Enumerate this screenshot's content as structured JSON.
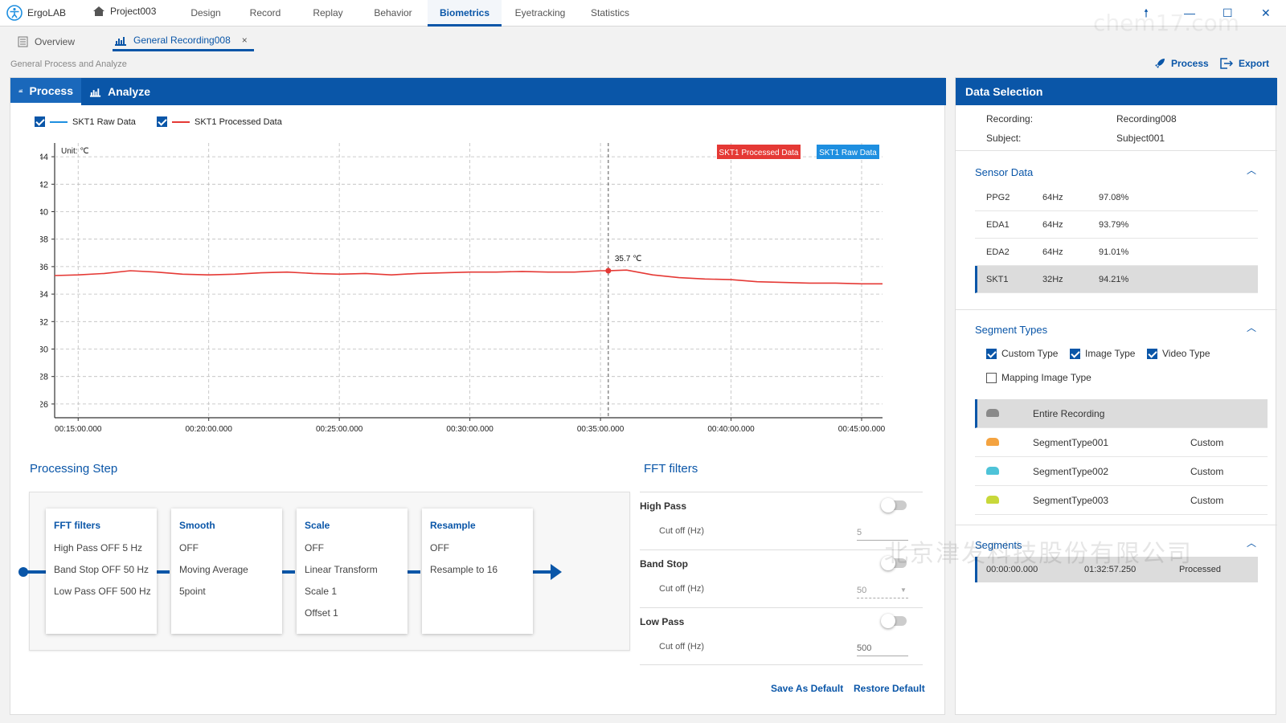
{
  "app": {
    "brand": "ErgoLAB",
    "project": "Project003"
  },
  "nav": [
    "Design",
    "Record",
    "Replay",
    "Behavior",
    "Biometrics",
    "Eyetracking",
    "Statistics"
  ],
  "nav_active": "Biometrics",
  "window_buttons": {
    "pin": "🠕",
    "minimize": "—",
    "maximize": "☐",
    "close": "✕"
  },
  "tabs": [
    {
      "label": "Overview"
    },
    {
      "label": "General Recording008",
      "close": "×"
    }
  ],
  "breadcrumb": "General Process and Analyze",
  "actions": {
    "process": "Process",
    "export": "Export"
  },
  "left_tabs": {
    "process": "Process",
    "analyze": "Analyze"
  },
  "legend": [
    {
      "label": "SKT1 Raw Data",
      "color": "#1e8fe0",
      "checked": true
    },
    {
      "label": "SKT1 Processed Data",
      "color": "#e53935",
      "checked": true
    }
  ],
  "chart_data": {
    "type": "line",
    "unit_label": "Unit: ℃",
    "ylim": [
      25,
      45
    ],
    "yticks": [
      26,
      28,
      30,
      32,
      34,
      36,
      38,
      40,
      42,
      44
    ],
    "xticks": [
      "00:15:00.000",
      "00:20:00.000",
      "00:25:00.000",
      "00:30:00.000",
      "00:35:00.000",
      "00:40:00.000",
      "00:45:00.000"
    ],
    "xtick_minutes": [
      15,
      20,
      25,
      30,
      35,
      40,
      45
    ],
    "xlim_minutes": [
      14.1,
      45.8
    ],
    "grid": true,
    "badges": [
      {
        "label": "SKT1 Processed Data",
        "color": "#e53935"
      },
      {
        "label": "SKT1 Raw Data",
        "color": "#1e8fe0"
      }
    ],
    "cursor": {
      "x_min": 35.3,
      "y": 35.7,
      "label": "35.7 ℃"
    },
    "series": [
      {
        "name": "SKT1 Processed Data",
        "color": "#e53935",
        "x": [
          14.1,
          15,
          16,
          17,
          18,
          19,
          20,
          21,
          22,
          23,
          24,
          25,
          26,
          27,
          28,
          29,
          30,
          31,
          32,
          33,
          34,
          35,
          35.3,
          36,
          37,
          38,
          39,
          40,
          41,
          42,
          43,
          44,
          45,
          45.8
        ],
        "y": [
          35.35,
          35.4,
          35.5,
          35.7,
          35.6,
          35.45,
          35.4,
          35.45,
          35.55,
          35.6,
          35.5,
          35.45,
          35.5,
          35.4,
          35.5,
          35.55,
          35.6,
          35.6,
          35.65,
          35.6,
          35.6,
          35.7,
          35.7,
          35.75,
          35.4,
          35.2,
          35.1,
          35.05,
          34.9,
          34.85,
          34.8,
          34.8,
          34.75,
          34.75
        ]
      }
    ]
  },
  "processing": {
    "title": "Processing Step",
    "steps": [
      {
        "title": "FFT filters",
        "lines": [
          "High Pass  OFF  5 Hz",
          "Band Stop  OFF  50 Hz",
          "Low Pass  OFF  500 Hz"
        ]
      },
      {
        "title": "Smooth",
        "lines": [
          "OFF",
          "Moving Average",
          "5point"
        ]
      },
      {
        "title": "Scale",
        "lines": [
          "OFF",
          "Linear Transform",
          "Scale  1",
          "Offset  1"
        ]
      },
      {
        "title": "Resample",
        "lines": [
          "OFF",
          "Resample to 16"
        ]
      }
    ]
  },
  "fft": {
    "title": "FFT filters",
    "filters": [
      {
        "label": "High Pass",
        "sub": "Cut off (Hz)",
        "value": "5",
        "on": false
      },
      {
        "label": "Band Stop",
        "sub": "Cut off (Hz)",
        "value": "50",
        "on": false
      },
      {
        "label": "Low Pass",
        "sub": "Cut off (Hz)",
        "value": "500",
        "on": false
      }
    ],
    "save": "Save As Default",
    "restore": "Restore Default"
  },
  "data_selection": {
    "title": "Data Selection",
    "recording_label": "Recording:",
    "recording": "Recording008",
    "subject_label": "Subject:",
    "subject": "Subject001",
    "sensor_title": "Sensor Data",
    "sensors": [
      {
        "name": "PPG2",
        "rate": "64Hz",
        "pct": "97.08%"
      },
      {
        "name": "EDA1",
        "rate": "64Hz",
        "pct": "93.79%"
      },
      {
        "name": "EDA2",
        "rate": "64Hz",
        "pct": "91.01%"
      },
      {
        "name": "SKT1",
        "rate": "32Hz",
        "pct": "94.21%"
      }
    ],
    "segment_types_title": "Segment Types",
    "segment_checks": [
      {
        "label": "Custom Type",
        "checked": true
      },
      {
        "label": "Image Type",
        "checked": true
      },
      {
        "label": "Video Type",
        "checked": true
      },
      {
        "label": "Mapping Image Type",
        "checked": false
      }
    ],
    "segment_types": [
      {
        "name": "Entire Recording",
        "type": "",
        "color": "#8a8a8a"
      },
      {
        "name": "SegmentType001",
        "type": "Custom",
        "color": "#f4a340"
      },
      {
        "name": "SegmentType002",
        "type": "Custom",
        "color": "#4ec3d8"
      },
      {
        "name": "SegmentType003",
        "type": "Custom",
        "color": "#c8d83a"
      }
    ],
    "segments_title": "Segments",
    "segments": [
      {
        "start": "00:00:00.000",
        "end": "01:32:57.250",
        "status": "Processed"
      }
    ]
  },
  "watermark": {
    "text": "chem17.com",
    "cn": "北京津发科技股份有限公司"
  }
}
